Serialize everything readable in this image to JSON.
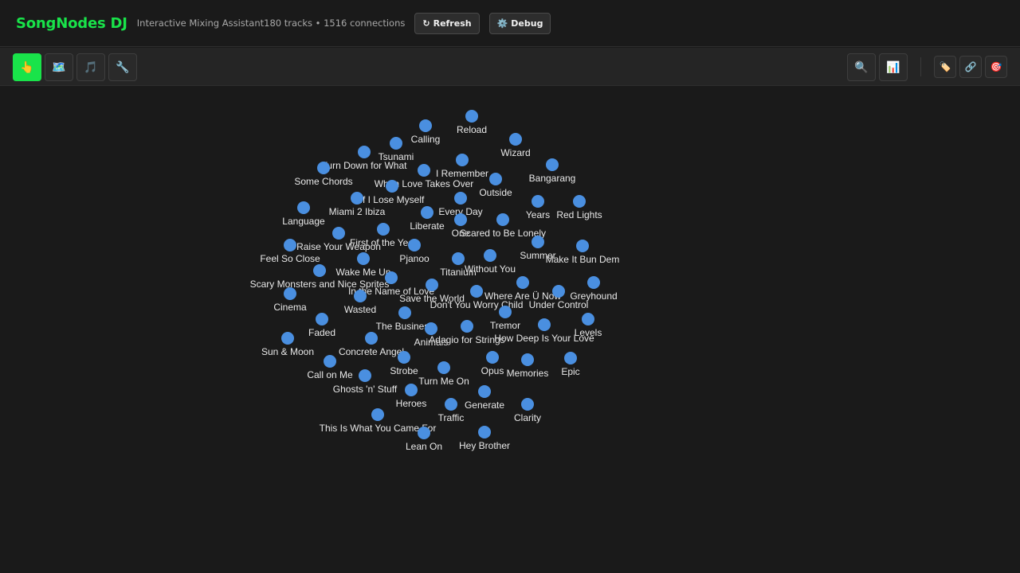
{
  "header": {
    "title": "SongNodes DJ",
    "subtitle": "Interactive Mixing Assistant180 tracks • 1516 connections",
    "refresh_icon": "↻",
    "refresh_label": "Refresh",
    "debug_icon": "⚙️",
    "debug_label": "Debug"
  },
  "toolbar": {
    "left_tools": [
      {
        "name": "select-tool-button",
        "icon": "👆",
        "icon_name": "pointer-hand-icon",
        "active": true
      },
      {
        "name": "map-tool-button",
        "icon": "🗺️",
        "icon_name": "map-icon",
        "active": false
      },
      {
        "name": "music-tool-button",
        "icon": "🎵",
        "icon_name": "music-note-icon",
        "active": false
      },
      {
        "name": "settings-tool-button",
        "icon": "🔧",
        "icon_name": "wrench-icon",
        "active": false
      }
    ],
    "right_tools": [
      {
        "name": "search-button",
        "icon": "🔍",
        "icon_name": "search-icon"
      },
      {
        "name": "stats-button",
        "icon": "📊",
        "icon_name": "bar-chart-icon"
      }
    ],
    "toggles": [
      {
        "name": "labels-toggle-button",
        "icon": "🏷️",
        "icon_name": "tag-icon"
      },
      {
        "name": "links-toggle-button",
        "icon": "🔗",
        "icon_name": "link-icon"
      },
      {
        "name": "target-toggle-button",
        "icon": "🎯",
        "icon_name": "target-icon"
      }
    ]
  },
  "graph": {
    "node_color": "#4a8fe0",
    "nodes": [
      {
        "label": "Reload"
      },
      {
        "label": "Calling"
      },
      {
        "label": "Wizard"
      },
      {
        "label": "Tsunami"
      },
      {
        "label": "Turn Down for What"
      },
      {
        "label": "I Remember"
      },
      {
        "label": "Bangarang"
      },
      {
        "label": "Some Chords"
      },
      {
        "label": "When Love Takes Over"
      },
      {
        "label": "Outside"
      },
      {
        "label": "If I Lose Myself"
      },
      {
        "label": "Every Day"
      },
      {
        "label": "Years"
      },
      {
        "label": "Red Lights"
      },
      {
        "label": "Language"
      },
      {
        "label": "Miami 2 Ibiza"
      },
      {
        "label": "Liberate"
      },
      {
        "label": "One"
      },
      {
        "label": "Scared to Be Lonely"
      },
      {
        "label": "First of the Year"
      },
      {
        "label": "Raise Your Weapon"
      },
      {
        "label": "Summer"
      },
      {
        "label": "Feel So Close"
      },
      {
        "label": "Pjanoo"
      },
      {
        "label": "Make It Bun Dem"
      },
      {
        "label": "Wake Me Up"
      },
      {
        "label": "Titanium"
      },
      {
        "label": "Without You"
      },
      {
        "label": "Scary Monsters and Nice Sprites"
      },
      {
        "label": "In the Name of Love"
      },
      {
        "label": "Save the World"
      },
      {
        "label": "Cinema"
      },
      {
        "label": "Where Are Ü Now"
      },
      {
        "label": "Greyhound"
      },
      {
        "label": "Wasted"
      },
      {
        "label": "Don't You Worry Child"
      },
      {
        "label": "Under Control"
      },
      {
        "label": "The Business"
      },
      {
        "label": "Tremor"
      },
      {
        "label": "Faded"
      },
      {
        "label": "Animals"
      },
      {
        "label": "Adagio for Strings"
      },
      {
        "label": "How Deep Is Your Love"
      },
      {
        "label": "Levels"
      },
      {
        "label": "Sun & Moon"
      },
      {
        "label": "Concrete Angel"
      },
      {
        "label": "Strobe"
      },
      {
        "label": "Opus"
      },
      {
        "label": "Memories"
      },
      {
        "label": "Epic"
      },
      {
        "label": "Call on Me"
      },
      {
        "label": "Turn Me On"
      },
      {
        "label": "Ghosts 'n' Stuff"
      },
      {
        "label": "Heroes"
      },
      {
        "label": "Generate"
      },
      {
        "label": "Traffic"
      },
      {
        "label": "Clarity"
      },
      {
        "label": "This Is What You Came For"
      },
      {
        "label": "Lean On"
      },
      {
        "label": "Hey Brother"
      }
    ]
  }
}
